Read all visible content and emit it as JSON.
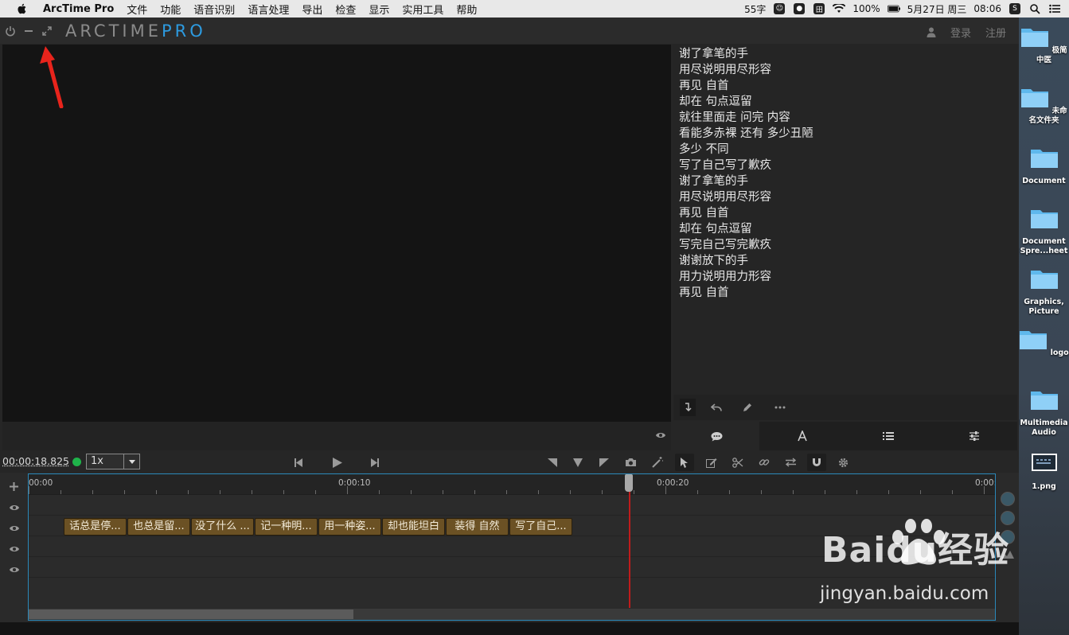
{
  "menubar": {
    "app_name": "ArcTime Pro",
    "items": [
      "文件",
      "功能",
      "语音识别",
      "语言处理",
      "导出",
      "检查",
      "显示",
      "实用工具",
      "帮助"
    ],
    "char_count": "55字",
    "battery": "100%",
    "date": "5月27日 周三",
    "time": "08:06"
  },
  "titlebar": {
    "brand_main": "ARCTIME",
    "brand_pro": "PRO",
    "login": "登录",
    "register": "注册"
  },
  "subtitles": [
    "谢了拿笔的手",
    "用尽说明用尽形容",
    "再见 自首",
    "却在 句点逗留",
    "就往里面走 问完 内容",
    "看能多赤裸 还有 多少丑陋",
    "多少 不同",
    "写了自己写了歉疚",
    "谢了拿笔的手",
    "用尽说明用尽形容",
    "再见 自首",
    "却在 句点逗留",
    "写完自己写完歉疚",
    "谢谢放下的手",
    "用力说明用力形容",
    "再见 自首"
  ],
  "transport": {
    "timecode": "00:00:18.825",
    "speed": "1x"
  },
  "timeline": {
    "ruler_labels": [
      "00:00",
      "0:00:10",
      "0:00:20",
      "0:00:"
    ],
    "clips": [
      "话总是停...",
      "也总是留...",
      "没了什么 ...",
      "记一种明...",
      "用一种姿...",
      "却也能坦白",
      "装得 自然",
      "写了自己..."
    ]
  },
  "desktop": {
    "items": [
      "极简中医",
      "未命名文件夹",
      "Document",
      "Document Spre...heet",
      "Graphics, Picture",
      "logo",
      "Multimedia Audio",
      "1.png"
    ]
  },
  "watermark": {
    "brand": "Baidu经验",
    "url": "jingyan.baidu.com"
  },
  "colors": {
    "accent": "#2d9be0",
    "clip": "#6b5124",
    "playhead": "#c11b1b",
    "arrow": "#e8241c"
  }
}
